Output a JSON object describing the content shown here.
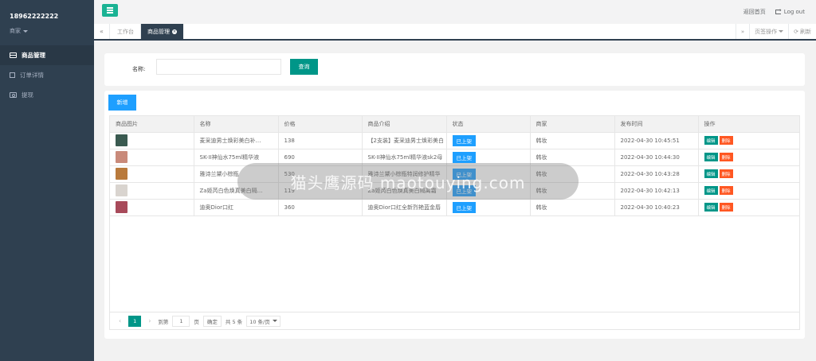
{
  "sidebar": {
    "username": "18962222222",
    "role": "商家",
    "items": [
      {
        "label": "商品管理",
        "icon": "card-icon",
        "active": true
      },
      {
        "label": "订单详情",
        "icon": "edit-icon",
        "active": false
      },
      {
        "label": "提现",
        "icon": "money-icon",
        "active": false
      }
    ]
  },
  "header": {
    "menu_icon": "hamburger-icon",
    "home_link": "返回首页",
    "logout": "Log out"
  },
  "tabs": {
    "home": "工作台",
    "active": "商品管理",
    "page_ops": "页签操作",
    "refresh": "刷新"
  },
  "search": {
    "label": "名称:",
    "value": "",
    "placeholder": "",
    "button": "查询"
  },
  "toolbar": {
    "add_label": "新增"
  },
  "table": {
    "columns": [
      "商品图片",
      "名称",
      "价格",
      "商品介绍",
      "状态",
      "商家",
      "发布时间",
      "操作"
    ],
    "rows": [
      {
        "name": "麦采迪男士焕彩美白补…",
        "price": "138",
        "intro": "【2支装】麦采迪男士焕彩美白",
        "status": "已上架",
        "merchant": "韩妆",
        "time": "2022-04-30 10:45:51",
        "thumb": "#3a5a50"
      },
      {
        "name": "SK-II神仙水75ml精华液",
        "price": "690",
        "intro": "SK-II神仙水75ml精华液sk2母",
        "status": "已上架",
        "merchant": "韩妆",
        "time": "2022-04-30 10:44:30",
        "thumb": "#c98a7a"
      },
      {
        "name": "雅诗兰黛小棕瓶",
        "price": "530",
        "intro": "雅诗兰黛小棕瓶特润修护精华",
        "status": "已上架",
        "merchant": "韩妆",
        "time": "2022-04-30 10:43:28",
        "thumb": "#b97a3c"
      },
      {
        "name": "Za姬芮白色焕真美白隔…",
        "price": "119",
        "intro": "Za姬芮白色焕真美白隔离霜",
        "status": "已上架",
        "merchant": "韩妆",
        "time": "2022-04-30 10:42:13",
        "thumb": "#d9d4cf"
      },
      {
        "name": "迪奥Dior口红",
        "price": "360",
        "intro": "迪奥Dior口红全新烈艳蓝金唇",
        "status": "已上架",
        "merchant": "韩妆",
        "time": "2022-04-30 10:40:23",
        "thumb": "#a84a5a"
      }
    ],
    "edit_label": "编辑",
    "delete_label": "删除"
  },
  "pagination": {
    "current_page": "1",
    "goto_label": "到第",
    "goto_value": "1",
    "page_unit": "页",
    "confirm": "确定",
    "total": "共 5 条",
    "page_size": "10 条/页"
  },
  "watermark": "猫头鹰源码 maotouying.com",
  "colors": {
    "sidebar_bg": "#2f4050",
    "primary": "#009688",
    "blue": "#1e9fff",
    "danger": "#ff5722",
    "menu_btn": "#1ab394"
  }
}
